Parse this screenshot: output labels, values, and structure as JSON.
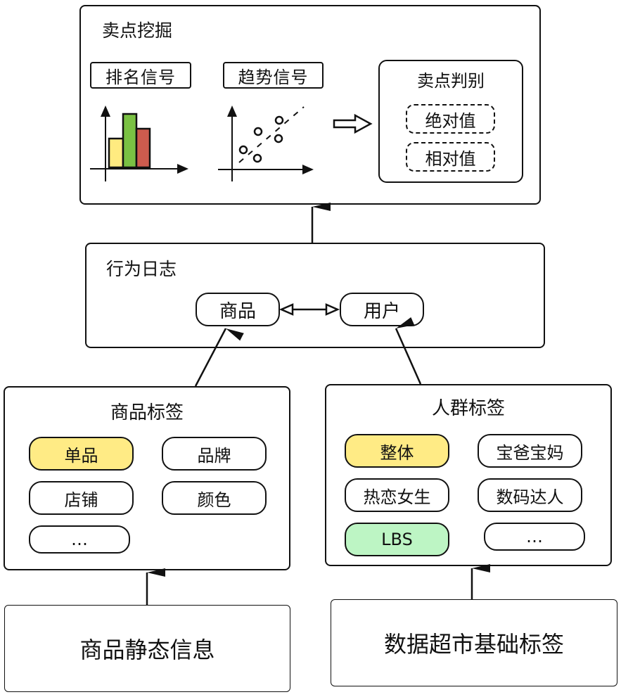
{
  "mining": {
    "title": "卖点挖掘",
    "rank_signal": "排名信号",
    "trend_signal": "趋势信号",
    "judge": {
      "title": "卖点判别",
      "items": [
        "绝对值",
        "相对值"
      ]
    },
    "bar_colors": [
      "#FFEB80",
      "#7AC143",
      "#CD5B4E"
    ]
  },
  "behavior_log": {
    "title": "行为日志",
    "product": "商品",
    "user": "用户"
  },
  "product_tags": {
    "title": "商品标签",
    "items": [
      "单品",
      "品牌",
      "店铺",
      "颜色",
      "…"
    ],
    "highlight_color": "#FFEB85"
  },
  "crowd_tags": {
    "title": "人群标签",
    "items": [
      "整体",
      "宝爸宝妈",
      "热恋女生",
      "数码达人",
      "LBS",
      "…"
    ],
    "highlight_color": "#FFEB85",
    "lbs_color": "#BDF5C4"
  },
  "product_static": {
    "title": "商品静态信息"
  },
  "data_market": {
    "title": "数据超市基础标签"
  }
}
